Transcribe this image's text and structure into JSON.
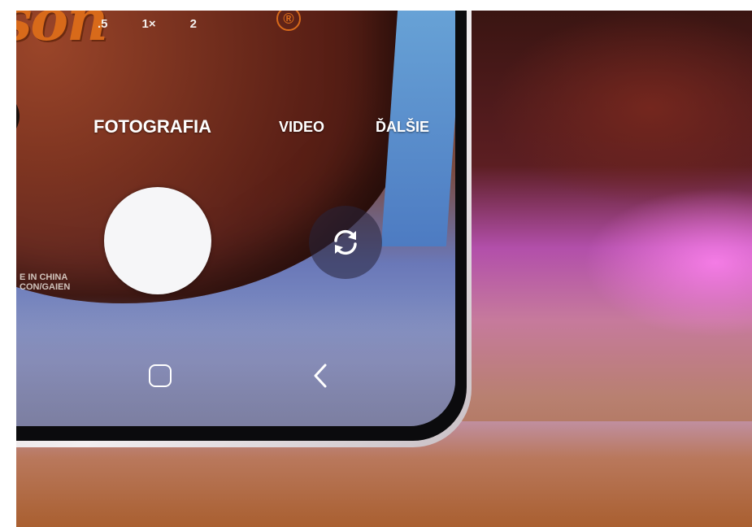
{
  "camera": {
    "zoom_levels": [
      ".5",
      "1×",
      "2"
    ],
    "modes": {
      "photo": "FOTOGRAFIA",
      "video": "VIDEO",
      "more": "ĎALŠIE"
    }
  },
  "scene": {
    "brand_text": "son",
    "registered_mark": "®",
    "label_line1": "E IN CHINA",
    "label_line2": "CON/GAIEN"
  },
  "icons": {
    "switch_camera": "switch-camera-icon",
    "home": "home-icon",
    "back": "back-icon"
  }
}
